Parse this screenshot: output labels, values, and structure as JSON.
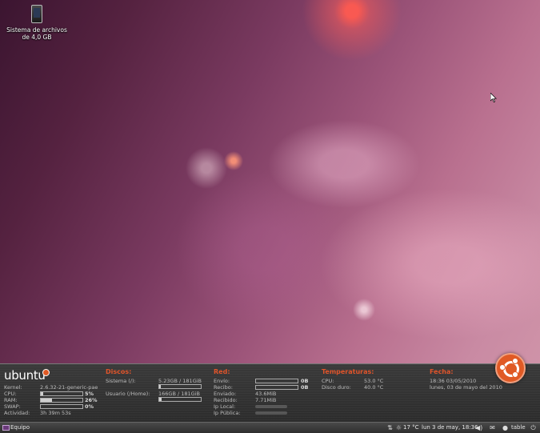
{
  "desktop": {
    "icon_label_line1": "Sistema de archivos",
    "icon_label_line2": "de 4,0 GB"
  },
  "info_panel": {
    "logo": "ubuntu",
    "system": {
      "kernel_label": "Kernel:",
      "kernel_value": "2.6.32-21-generic-pae",
      "cpu_label": "CPU:",
      "cpu_value": "5%",
      "cpu_fraction": 0.05,
      "ram_label": "RAM:",
      "ram_value": "26%",
      "ram_fraction": 0.26,
      "swap_label": "SWAP:",
      "swap_value": "0%",
      "swap_fraction": 0.0,
      "uptime_label": "Actividad:",
      "uptime_value": "3h 39m 53s"
    },
    "disks": {
      "title": "Discos:",
      "system_label": "Sistema (/):",
      "system_value": "5.23GB / 181GiB",
      "system_fraction": 0.03,
      "home_label": "Usuario (/Home):",
      "home_value": "166GB / 181GiB",
      "home_fraction": 0.06
    },
    "network": {
      "title": "Red:",
      "send_label": "Envío:",
      "send_value": "0B",
      "recv_label": "Recibo:",
      "recv_value": "0B",
      "sent_label": "Enviado:",
      "sent_value": "43.6MiB",
      "received_label": "Recibido:",
      "received_value": "7.71MiB",
      "local_ip_label": "Ip Local:",
      "public_ip_label": "Ip Pública:"
    },
    "temperatures": {
      "title": "Temperaturas:",
      "cpu_label": "CPU:",
      "cpu_value": "53.0 °C",
      "disk_label": "Disco duro:",
      "disk_value": "40.0 °C"
    },
    "date": {
      "title": "Fecha:",
      "time_line": "18:36  03/05/2010",
      "date_line": "lunes, 03 de mayo del 2010"
    }
  },
  "taskbar": {
    "start_label": "Equipo",
    "weather": "17 °C",
    "clock": "lun  3 de may, 18:36",
    "user": "table"
  }
}
